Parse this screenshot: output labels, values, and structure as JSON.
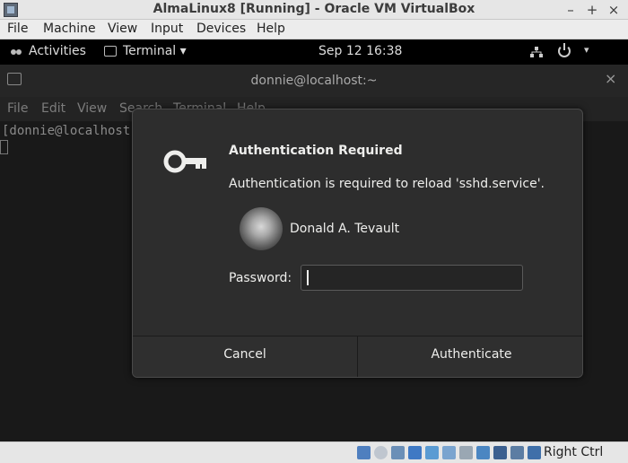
{
  "host": {
    "title": "AlmaLinux8 [Running] - Oracle VM VirtualBox",
    "controls": {
      "minimize": "–",
      "maximize": "+",
      "close": "×"
    },
    "menu": [
      "File",
      "Machine",
      "View",
      "Input",
      "Devices",
      "Help"
    ],
    "status": {
      "host_key": "Right Ctrl"
    }
  },
  "gnome": {
    "activities": "Activities",
    "app_menu": "Terminal ▾",
    "clock": "Sep 12  16:38",
    "system_menu_arrow": "▾"
  },
  "terminal": {
    "window_title": "donnie@localhost:~",
    "close": "×",
    "menu": [
      "File",
      "Edit",
      "View",
      "Search",
      "Terminal",
      "Help"
    ],
    "line": "[donnie@localhost ~]$ systemctl reload sshd"
  },
  "dialog": {
    "title": "Authentication Required",
    "message": "Authentication is required to reload 'sshd.service'.",
    "user_name": "Donald A. Tevault",
    "password_label": "Password:",
    "password_value": "",
    "cancel_label": "Cancel",
    "authenticate_label": "Authenticate"
  },
  "colors": {
    "dialog_bg": "#2d2d2d",
    "dialog_text": "#eeeeec",
    "terminal_bg": "#191919",
    "gnome_bar": "#000000",
    "host_chrome": "#e6e6e6"
  }
}
